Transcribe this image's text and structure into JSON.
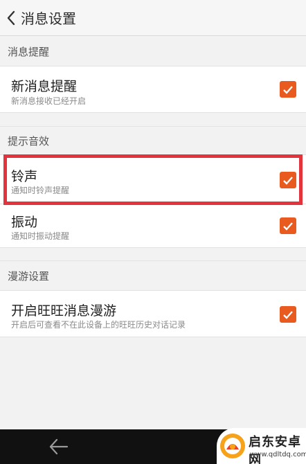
{
  "header": {
    "title": "消息设置"
  },
  "sections": {
    "notify": {
      "title": "消息提醒",
      "new_message": {
        "label": "新消息提醒",
        "sub": "新消息接收已经开启",
        "checked": true
      }
    },
    "sound": {
      "title": "提示音效",
      "ringtone": {
        "label": "铃声",
        "sub": "通知时铃声提醒",
        "checked": true
      },
      "vibrate": {
        "label": "振动",
        "sub": "通知时振动提醒",
        "checked": true
      }
    },
    "roaming": {
      "title": "漫游设置",
      "wangwang": {
        "label": "开启旺旺消息漫游",
        "sub": "开启后可查看不在此设备上的旺旺历史对话记录",
        "checked": true
      }
    }
  },
  "watermark": {
    "name": "启东安卓网",
    "url": "www.qdltdq.com"
  },
  "colors": {
    "accent": "#e85a1e",
    "highlight": "#e3333c"
  }
}
